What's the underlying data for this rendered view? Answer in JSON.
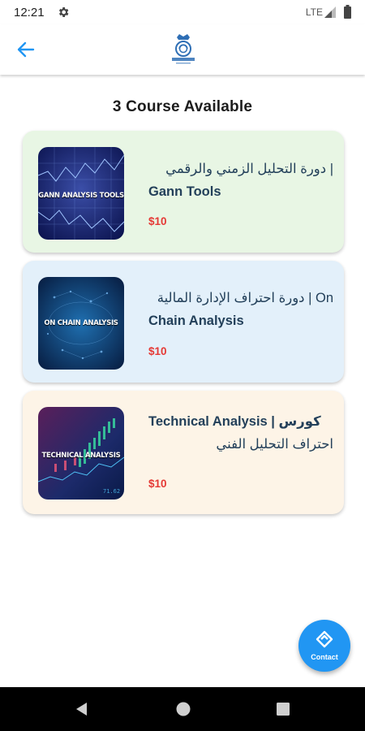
{
  "status_bar": {
    "time": "12:21",
    "network": "LTE"
  },
  "app_bar": {
    "back_icon": "arrow-left-icon",
    "logo_icon": "logo-crest-icon",
    "accent_color": "#2196f3"
  },
  "heading": "3 Course Available",
  "courses": [
    {
      "title": "دورة التحليل الزمني والرقمي | Gann Tools",
      "title_line1": "| دورة التحليل الزمني والرقمي",
      "title_line2": "Gann Tools",
      "price": "$10",
      "thumb_label": "GANN ANALYSIS TOOLS",
      "card_color": "#e8f6e4"
    },
    {
      "title": "دورة احتراف الإدارة المالية | On Chain Analysis",
      "title_line1": "On | دورة احتراف الإدارة المالية",
      "title_line2": "Chain Analysis",
      "price": "$10",
      "thumb_label": "ON CHAIN ANALYSIS",
      "card_color": "#e3f0fa"
    },
    {
      "title": "Technical Analysis | كورس احتراف التحليل الفني",
      "title_line1": "Technical Analysis |  كورس",
      "title_line2": "احتراف التحليل الفني",
      "price": "$10",
      "thumb_label": "TECHNICAL ANALYSIS",
      "card_color": "#fdf4e7"
    }
  ],
  "fab": {
    "label": "Contact",
    "icon": "handshake-icon"
  },
  "nav": {
    "back": "nav-back-icon",
    "home": "nav-home-icon",
    "recents": "nav-recents-icon"
  }
}
